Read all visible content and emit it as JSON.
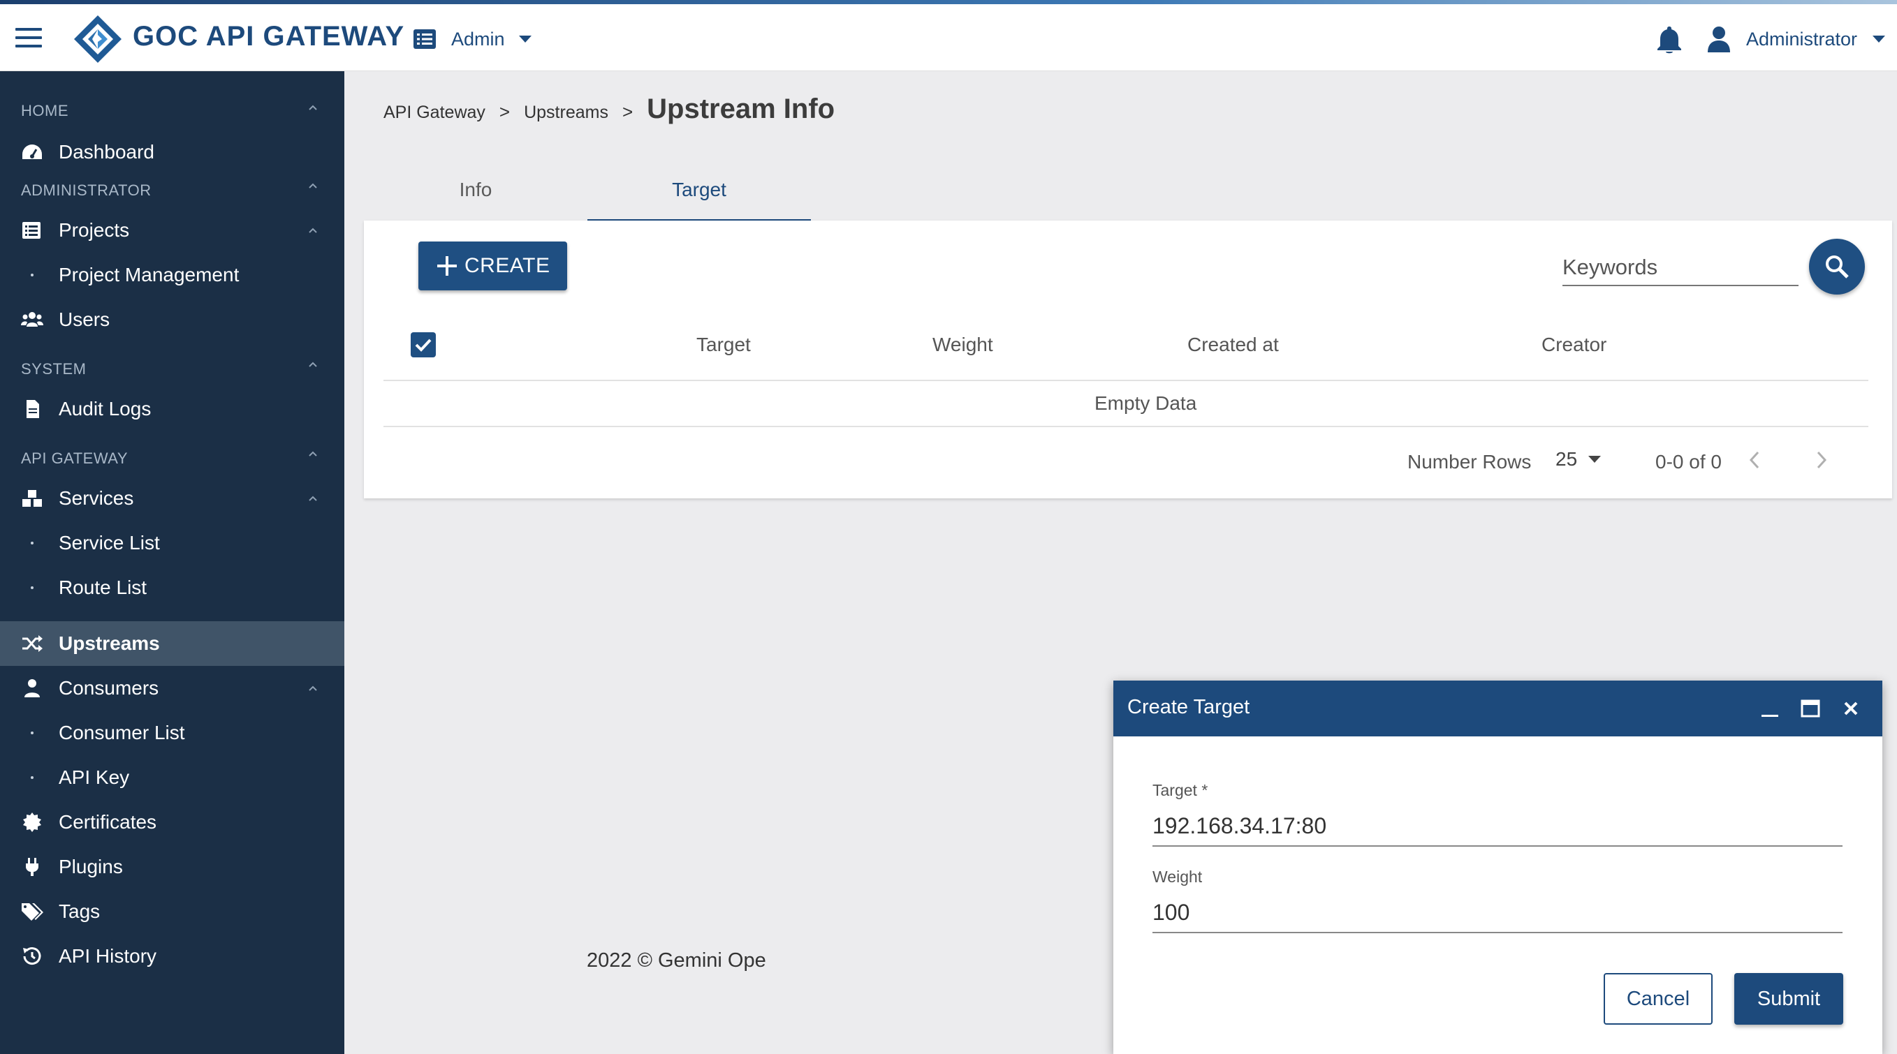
{
  "header": {
    "brand": "GOC API GATEWAY",
    "role_menu": "Admin",
    "user_menu": "Administrator"
  },
  "sidebar": {
    "sections": {
      "home": "HOME",
      "administrator": "ADMINISTRATOR",
      "system": "SYSTEM",
      "api_gateway": "API GATEWAY"
    },
    "items": {
      "dashboard": "Dashboard",
      "projects": "Projects",
      "project_management": "Project Management",
      "users": "Users",
      "audit_logs": "Audit Logs",
      "services": "Services",
      "service_list": "Service List",
      "route_list": "Route List",
      "upstreams": "Upstreams",
      "consumers": "Consumers",
      "consumer_list": "Consumer List",
      "api_key": "API Key",
      "certificates": "Certificates",
      "plugins": "Plugins",
      "tags": "Tags",
      "api_history": "API History"
    },
    "active_item": "Upstreams"
  },
  "breadcrumb": {
    "items": [
      "API Gateway",
      "Upstreams"
    ],
    "separator": ">",
    "current": "Upstream Info"
  },
  "tabs": [
    {
      "label": "Info",
      "active": false
    },
    {
      "label": "Target",
      "active": true
    }
  ],
  "table": {
    "create_label": "CREATE",
    "search_placeholder": "Keywords",
    "select_all_checked": true,
    "columns": [
      "Target",
      "Weight",
      "Created at",
      "Creator"
    ],
    "empty_text": "Empty Data",
    "pagination": {
      "rows_label": "Number Rows",
      "rows_value": "25",
      "range": "0-0 of 0"
    }
  },
  "footer": {
    "text": "2022 © Gemini Ope"
  },
  "dialog": {
    "title": "Create Target",
    "target_label": "Target *",
    "target_value": "192.168.34.17:80",
    "weight_label": "Weight",
    "weight_value": "100",
    "cancel_label": "Cancel",
    "submit_label": "Submit"
  },
  "colors": {
    "brand": "#1d4a7c",
    "sidebar_bg": "#1b2f46",
    "sidebar_active": "#405468",
    "page_bg": "#ececee"
  }
}
